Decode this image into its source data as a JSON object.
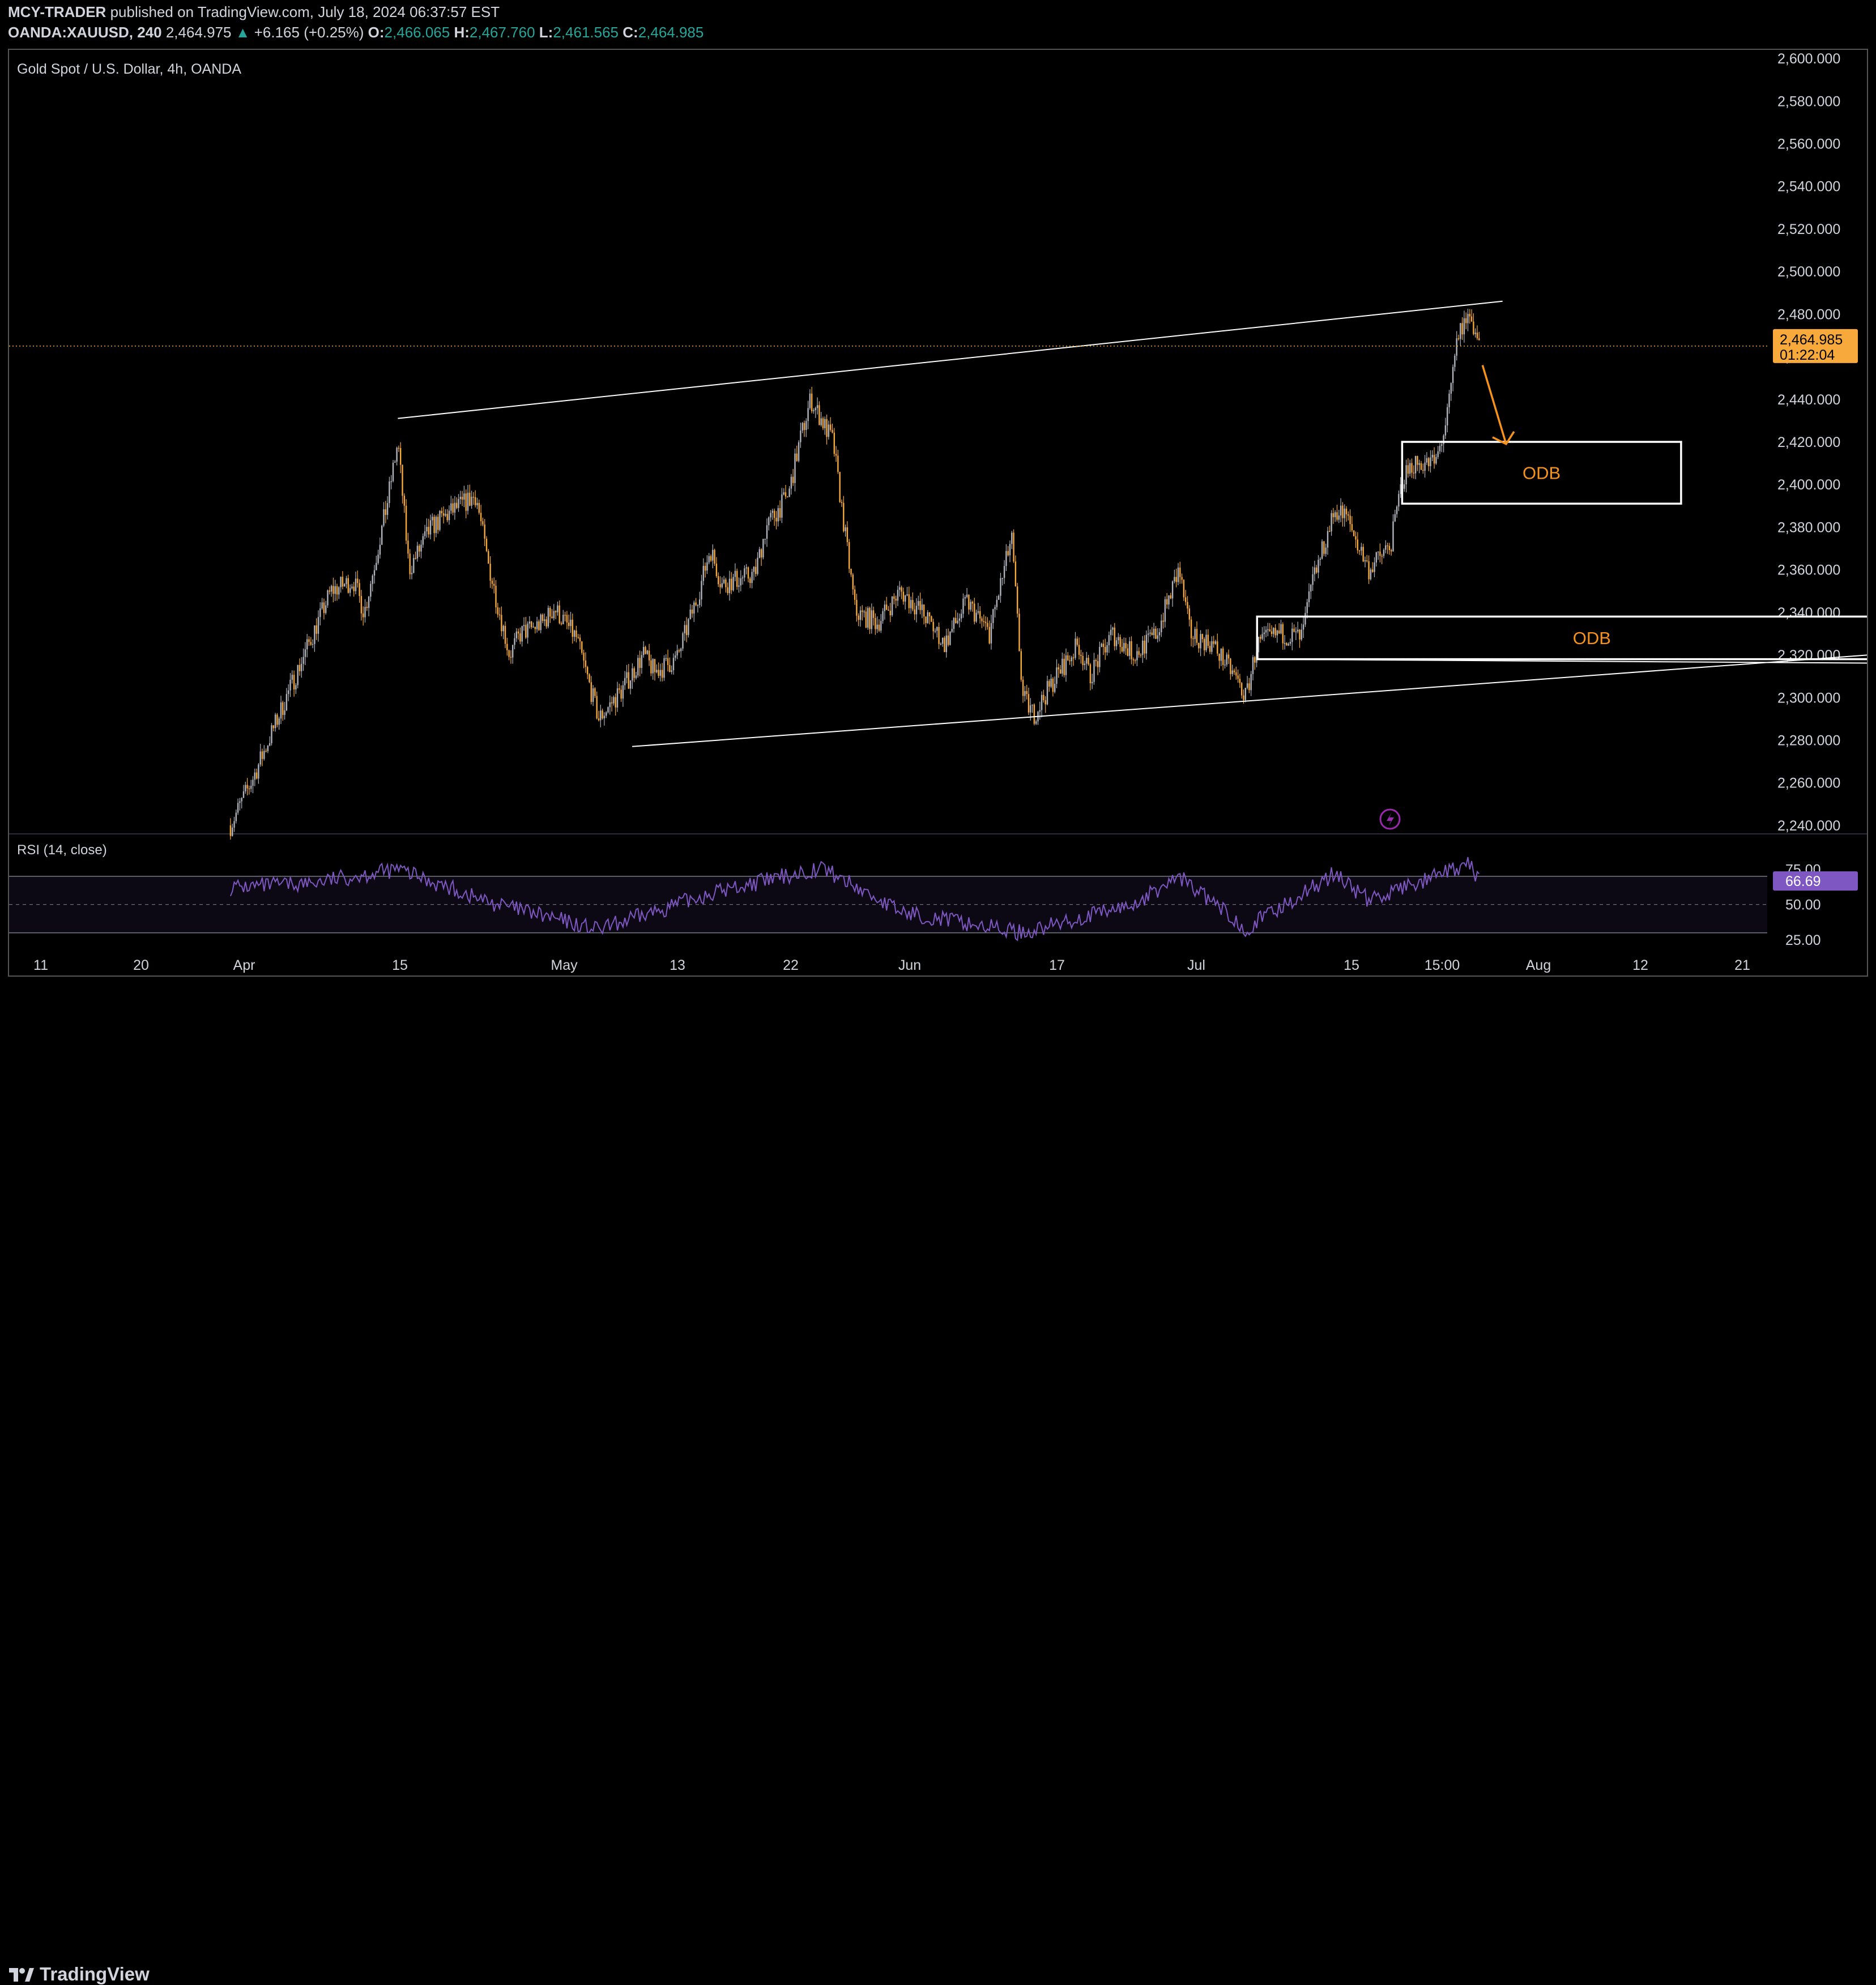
{
  "header": {
    "author": "MCY-TRADER",
    "published": "published on TradingView.com, July 18, 2024 06:37:57 EST",
    "symbol": "OANDA:XAUUSD, 240",
    "price": "2,464.975",
    "change_arrow": "▲",
    "change": "+6.165 (+0.25%)",
    "o_label": "O:",
    "o_value": "2,466.065",
    "h_label": "H:",
    "h_value": "2,467.760",
    "l_label": "L:",
    "l_value": "2,461.565",
    "c_label": "C:",
    "c_value": "2,464.985"
  },
  "chart_title": "Gold Spot / U.S. Dollar, 4h, OANDA",
  "rsi_label": "RSI (14, close)",
  "price_tag": {
    "price": "2,464.985",
    "countdown": "01:22:04",
    "color": "#f7a93b"
  },
  "rsi_tag": {
    "value": "66.69",
    "color": "#7e57c2"
  },
  "annotations": {
    "zone_upper_label": "ODB",
    "zone_lower_label": "ODB"
  },
  "branding": {
    "logo_text": "TradingView"
  },
  "colors": {
    "background": "#000000",
    "candle_up": "#b2b5be",
    "candle_down": "#f7a93b",
    "annotation": "#f7931a",
    "rsi_line": "#7e57c2",
    "trendline": "#ffffff"
  },
  "chart_data": [
    {
      "type": "candlestick",
      "title": "Gold Spot / U.S. Dollar, 4h, OANDA",
      "y_ticks": [
        "2,600.000",
        "2,580.000",
        "2,560.000",
        "2,540.000",
        "2,520.000",
        "2,500.000",
        "2,480.000",
        "2,460.000",
        "2,440.000",
        "2,420.000",
        "2,400.000",
        "2,380.000",
        "2,360.000",
        "2,340.000",
        "2,320.000",
        "2,300.000",
        "2,280.000",
        "2,260.000",
        "2,240.000"
      ],
      "ylim": [
        2236,
        2604
      ],
      "x_ticks": [
        "11",
        "20",
        "Apr",
        "15",
        "May",
        "13",
        "22",
        "Jun",
        "17",
        "Jul",
        "15",
        "15:00",
        "Aug",
        "12",
        "21"
      ],
      "last_price": 2464.985,
      "path_points": [
        [
          "2024-03-28",
          2240
        ],
        [
          "2024-03-30",
          2262
        ],
        [
          "2024-04-02",
          2300
        ],
        [
          "2024-04-04",
          2325
        ],
        [
          "2024-04-06",
          2350
        ],
        [
          "2024-04-08",
          2355
        ],
        [
          "2024-04-09",
          2340
        ],
        [
          "2024-04-11",
          2390
        ],
        [
          "2024-04-12",
          2420
        ],
        [
          "2024-04-13",
          2360
        ],
        [
          "2024-04-15",
          2380
        ],
        [
          "2024-04-17",
          2388
        ],
        [
          "2024-04-19",
          2395
        ],
        [
          "2024-04-20",
          2365
        ],
        [
          "2024-04-22",
          2320
        ],
        [
          "2024-04-23",
          2330
        ],
        [
          "2024-04-25",
          2335
        ],
        [
          "2024-04-26",
          2342
        ],
        [
          "2024-04-28",
          2328
        ],
        [
          "2024-04-30",
          2290
        ],
        [
          "2024-05-02",
          2303
        ],
        [
          "2024-05-04",
          2320
        ],
        [
          "2024-05-05",
          2312
        ],
        [
          "2024-05-07",
          2318
        ],
        [
          "2024-05-09",
          2350
        ],
        [
          "2024-05-10",
          2370
        ],
        [
          "2024-05-11",
          2353
        ],
        [
          "2024-05-14",
          2358
        ],
        [
          "2024-05-15",
          2380
        ],
        [
          "2024-05-17",
          2395
        ],
        [
          "2024-05-18",
          2420
        ],
        [
          "2024-05-19",
          2440
        ],
        [
          "2024-05-20",
          2430
        ],
        [
          "2024-05-21",
          2420
        ],
        [
          "2024-05-22",
          2380
        ],
        [
          "2024-05-23",
          2340
        ],
        [
          "2024-05-25",
          2335
        ],
        [
          "2024-05-27",
          2350
        ],
        [
          "2024-05-29",
          2340
        ],
        [
          "2024-05-31",
          2325
        ],
        [
          "2024-06-02",
          2345
        ],
        [
          "2024-06-04",
          2330
        ],
        [
          "2024-06-06",
          2375
        ],
        [
          "2024-06-07",
          2300
        ],
        [
          "2024-06-08",
          2292
        ],
        [
          "2024-06-10",
          2310
        ],
        [
          "2024-06-12",
          2325
        ],
        [
          "2024-06-13",
          2310
        ],
        [
          "2024-06-15",
          2330
        ],
        [
          "2024-06-17",
          2320
        ],
        [
          "2024-06-19",
          2330
        ],
        [
          "2024-06-21",
          2360
        ],
        [
          "2024-06-22",
          2330
        ],
        [
          "2024-06-24",
          2325
        ],
        [
          "2024-06-26",
          2310
        ],
        [
          "2024-06-27",
          2300
        ],
        [
          "2024-06-28",
          2325
        ],
        [
          "2024-06-30",
          2330
        ],
        [
          "2024-07-02",
          2328
        ],
        [
          "2024-07-03",
          2355
        ],
        [
          "2024-07-05",
          2388
        ],
        [
          "2024-07-06",
          2385
        ],
        [
          "2024-07-08",
          2360
        ],
        [
          "2024-07-10",
          2372
        ],
        [
          "2024-07-11",
          2402
        ],
        [
          "2024-07-12",
          2410
        ],
        [
          "2024-07-14",
          2410
        ],
        [
          "2024-07-15",
          2430
        ],
        [
          "2024-07-16",
          2470
        ],
        [
          "2024-07-17",
          2480
        ],
        [
          "2024-07-18",
          2465
        ]
      ],
      "trendlines": [
        {
          "from": [
            "2024-04-12",
            2431
          ],
          "to": [
            "2024-07-20",
            2486
          ]
        },
        {
          "from": [
            "2024-05-03",
            2277
          ],
          "to": [
            "2024-08-27",
            2322
          ]
        },
        {
          "from": [
            "2024-06-28",
            2318
          ],
          "to": [
            "2024-08-27",
            2316
          ]
        }
      ],
      "zones": [
        {
          "label": "ODB",
          "x_from": "2024-07-11",
          "x_to": "2024-08-05",
          "y_top": 2420,
          "y_bottom": 2391
        },
        {
          "label": "ODB",
          "x_from": "2024-06-28",
          "x_to": "2024-08-27",
          "y_top": 2338,
          "y_bottom": 2318
        }
      ],
      "projection_arrow": {
        "from": [
          "2024-07-18",
          2456
        ],
        "to": [
          "2024-07-19",
          2419
        ]
      }
    },
    {
      "type": "line",
      "title": "RSI (14, close)",
      "y_ticks": [
        "75.00",
        "50.00",
        "25.00"
      ],
      "ylim": [
        15,
        100
      ],
      "band": [
        30,
        70
      ],
      "last_value": 66.69,
      "path_points": [
        [
          "2024-03-28",
          62
        ],
        [
          "2024-04-04",
          65
        ],
        [
          "2024-04-12",
          75
        ],
        [
          "2024-04-20",
          52
        ],
        [
          "2024-04-30",
          32
        ],
        [
          "2024-05-10",
          58
        ],
        [
          "2024-05-20",
          76
        ],
        [
          "2024-05-27",
          45
        ],
        [
          "2024-06-07",
          30
        ],
        [
          "2024-06-17",
          50
        ],
        [
          "2024-06-21",
          70
        ],
        [
          "2024-06-27",
          33
        ],
        [
          "2024-07-05",
          72
        ],
        [
          "2024-07-08",
          53
        ],
        [
          "2024-07-17",
          78
        ],
        [
          "2024-07-18",
          67
        ]
      ]
    }
  ]
}
